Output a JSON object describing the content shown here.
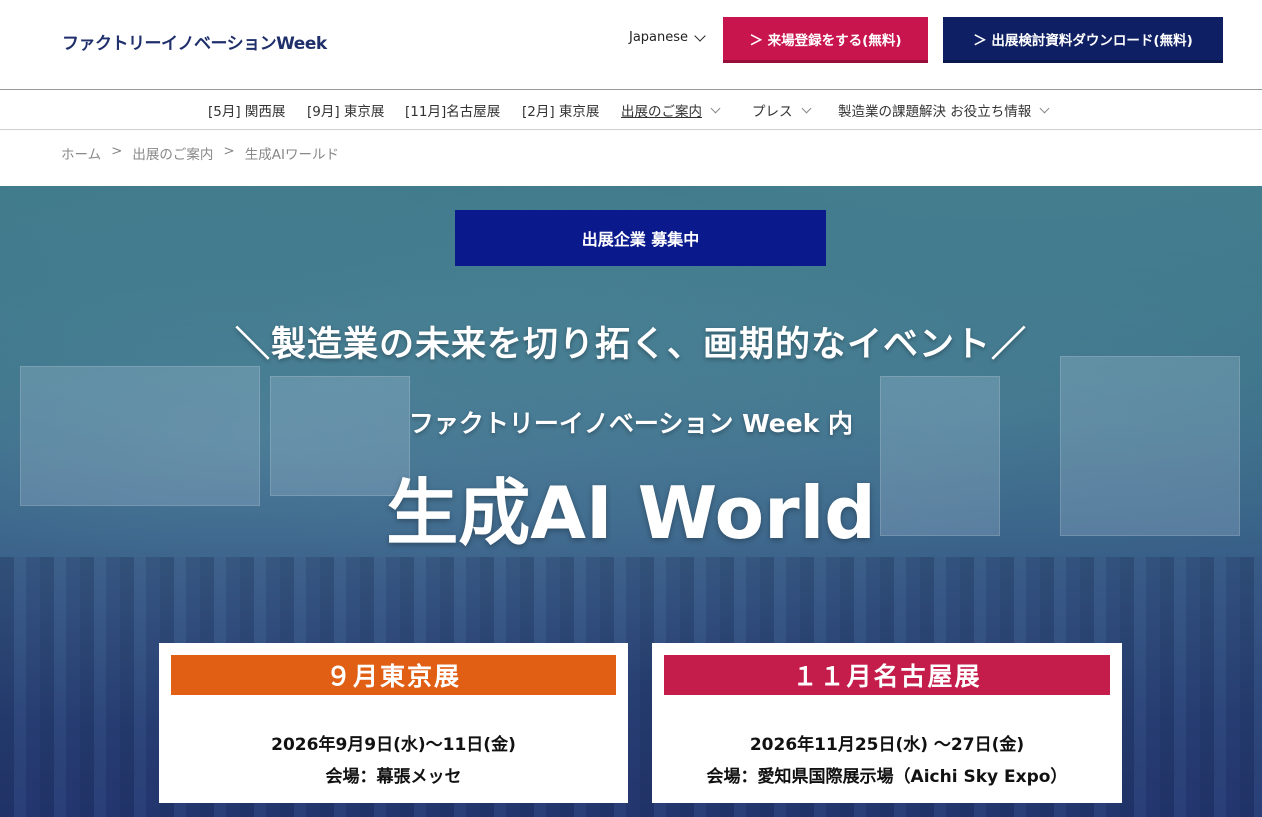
{
  "header": {
    "logo": "ファクトリーイノベーションWeek",
    "language": "Japanese",
    "register_button": "＞ 来場登録をする(無料)",
    "download_button": "＞ 出展検討資料ダウンロード(無料)"
  },
  "nav": {
    "items": [
      {
        "label": "[5月] 関西展"
      },
      {
        "label": "[9月] 東京展"
      },
      {
        "label": "[11月]名古屋展"
      },
      {
        "label": "[2月] 東京展"
      },
      {
        "label": "出展のご案内"
      },
      {
        "label": "プレス"
      },
      {
        "label": "製造業の課題解決 お役立ち情報"
      }
    ]
  },
  "breadcrumb": {
    "items": [
      "ホーム",
      "出展のご案内",
      "生成AIワールド"
    ],
    "separator": ">"
  },
  "hero": {
    "badge": "出展企業 募集中",
    "tagline": "＼製造業の未来を切り拓く、画期的なイベント／",
    "subtitle": "ファクトリーイノベーション Week 内",
    "title": "生成AI World",
    "cards": [
      {
        "header": "９月東京展",
        "date": "2026年9月9日(水)〜11日(金)",
        "venue": "会場：幕張メッセ"
      },
      {
        "header": "１１月名古屋展",
        "date": "2026年11月25日(水) 〜27日(金)",
        "venue": "会場：愛知県国際展示場（Aichi Sky Expo）"
      }
    ]
  },
  "colors": {
    "brand_navy": "#0e1f63",
    "register_red": "#c8154e",
    "tokyo_orange": "#e05f14",
    "nagoya_red": "#c51d4b",
    "badge_blue": "#0a1a8c"
  }
}
